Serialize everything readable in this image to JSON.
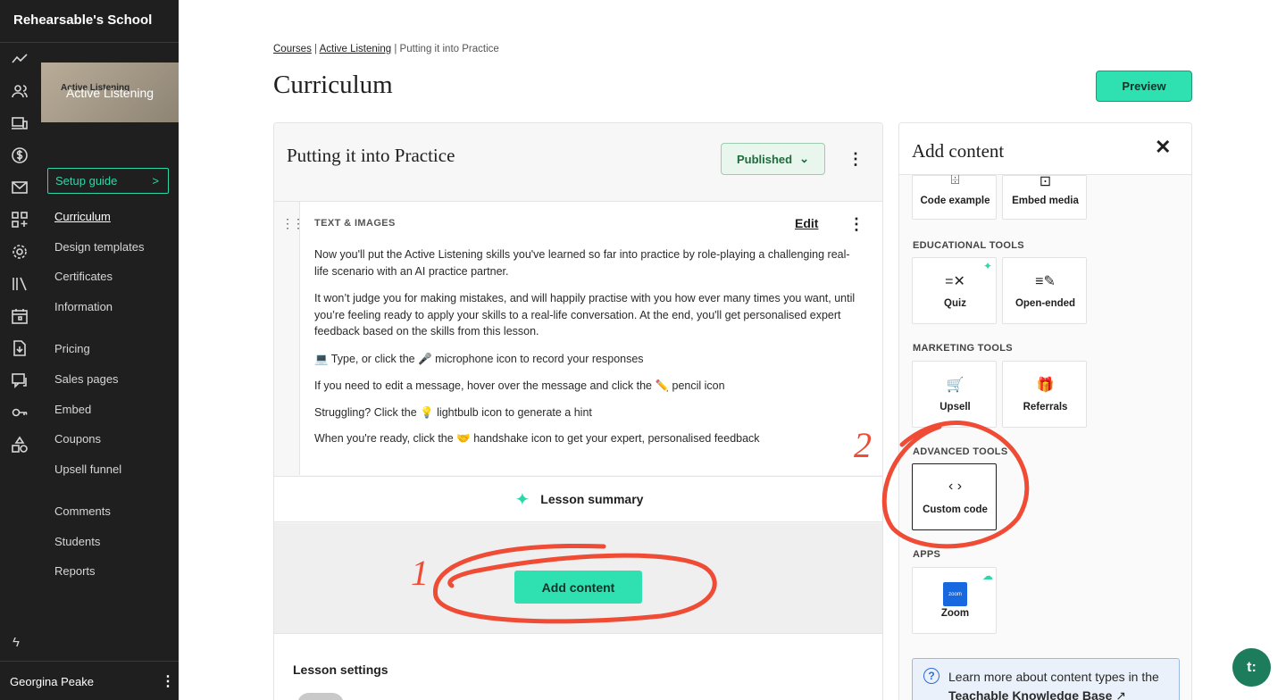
{
  "school": {
    "name": "Rehearsable's School"
  },
  "course_thumb": {
    "title": "Active Listening",
    "small_title": "Active Listening"
  },
  "setup_guide": {
    "label": "Setup guide",
    "chevron": ">"
  },
  "sidebar_nav": {
    "curriculum": "Curriculum",
    "design_templates": "Design templates",
    "certificates": "Certificates",
    "information": "Information",
    "pricing": "Pricing",
    "sales_pages": "Sales pages",
    "embed": "Embed",
    "coupons": "Coupons",
    "upsell_funnel": "Upsell funnel",
    "comments": "Comments",
    "students": "Students",
    "reports": "Reports"
  },
  "user": {
    "name": "Georgina Peake"
  },
  "breadcrumb": {
    "courses": "Courses",
    "course": "Active Listening",
    "current": "Putting it into Practice",
    "sep": "|"
  },
  "page": {
    "title": "Curriculum",
    "preview_label": "Preview"
  },
  "lesson": {
    "title": "Putting it into Practice",
    "status": "Published",
    "block_label": "TEXT & IMAGES",
    "edit_label": "Edit",
    "paragraphs": [
      "Now you'll put the Active Listening skills you've learned so far into practice by role-playing a challenging real-life scenario with an AI practice partner.",
      "It won’t judge you for making mistakes, and will happily practise with you how ever many times you want, until you’re feeling ready to apply your skills to a real-life conversation. At the end, you'll get personalised expert feedback based on the skills from this lesson.",
      "💻 Type, or click the 🎤 microphone icon to record your responses",
      "If you need to edit a message, hover over the message and click the ✏️ pencil icon",
      "Struggling? Click the 💡 lightbulb icon to generate a hint",
      "When you're ready, click the 🤝 handshake icon to get your expert, personalised feedback"
    ],
    "summary_label": "Lesson summary",
    "add_content_label": "Add content",
    "settings_title": "Lesson settings"
  },
  "panel": {
    "title": "Add content",
    "tiles_top": [
      {
        "label": "Code example",
        "icon": "code-example-icon"
      },
      {
        "label": "Embed media",
        "icon": "embed-media-icon"
      }
    ],
    "educational": {
      "label": "EDUCATIONAL TOOLS",
      "quiz": "Quiz",
      "open_ended": "Open-ended"
    },
    "marketing": {
      "label": "MARKETING TOOLS",
      "upsell": "Upsell",
      "referrals": "Referrals"
    },
    "advanced": {
      "label": "ADVANCED TOOLS",
      "custom_code": "Custom code"
    },
    "apps": {
      "label": "APPS",
      "zoom": "Zoom",
      "zoom_logo": "zoom"
    },
    "kb": {
      "text": "Learn more about content types in the ",
      "link": "Teachable Knowledge Base"
    }
  },
  "annotations": {
    "one": "1",
    "two": "2"
  },
  "chat": {
    "label": "t:"
  },
  "colors": {
    "accent": "#2fe0b0",
    "sidebar_bg": "#1f1f1f",
    "annotation": "#ef4b35"
  }
}
